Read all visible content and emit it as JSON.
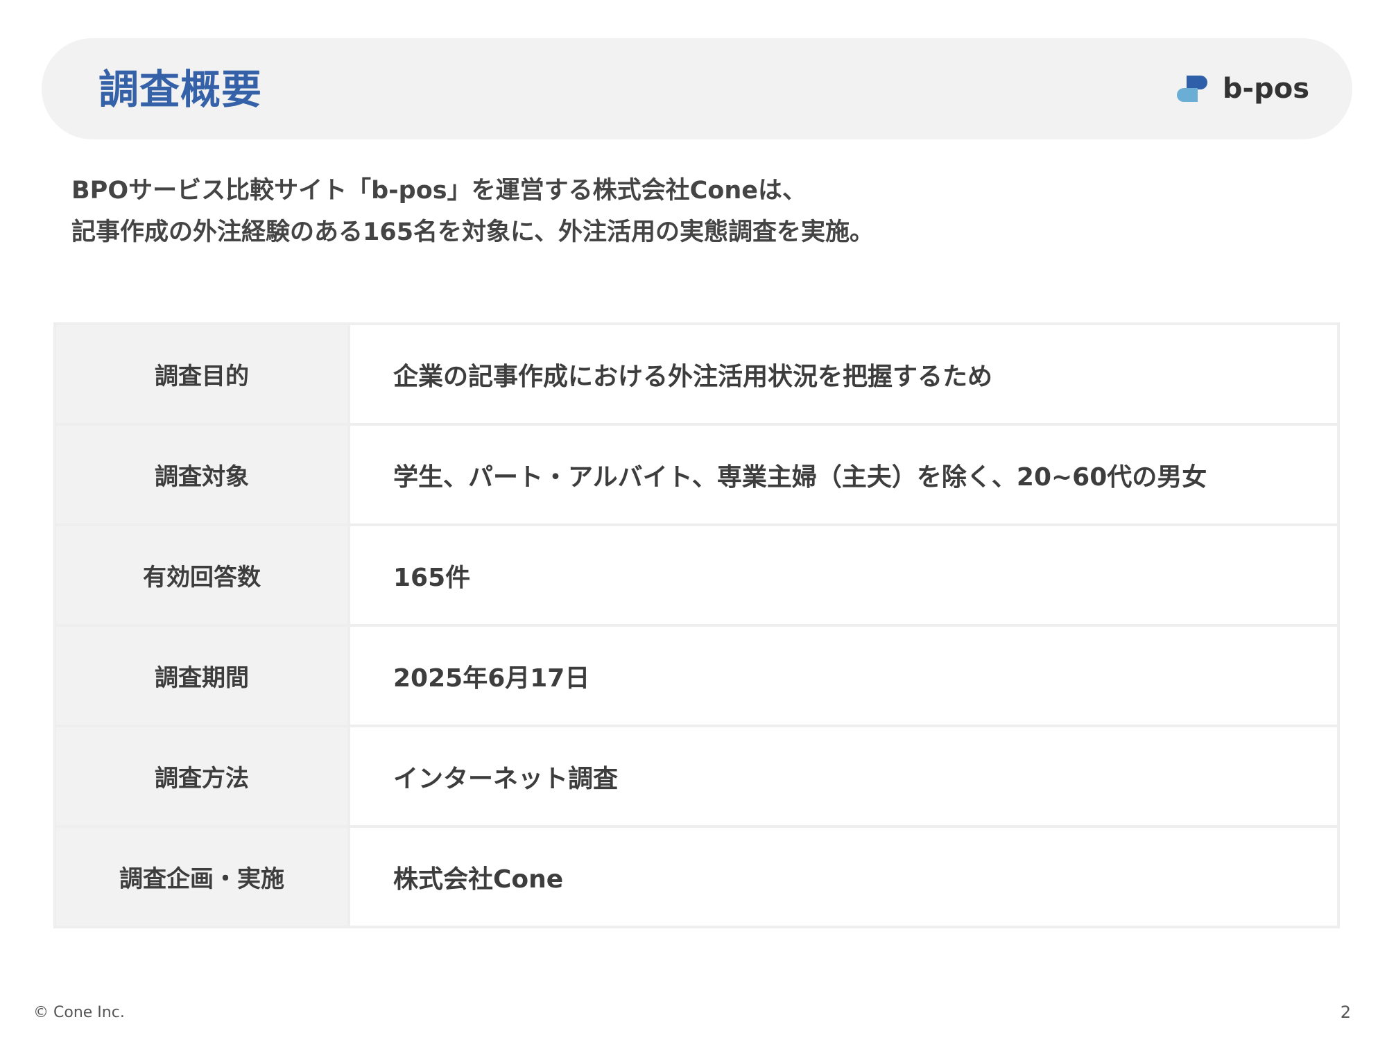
{
  "header": {
    "title": "調査概要",
    "logo_text": "b-pos",
    "logo_colors": [
      "#2f5fa8",
      "#6aaed6"
    ]
  },
  "intro": {
    "lines": [
      "BPOサービス比較サイト「b-pos」を運営する株式会社Coneは、",
      "記事作成の外注経験のある165名を対象に、外注活用の実態調査を実施。"
    ]
  },
  "table": {
    "rows": [
      {
        "label": "調査目的",
        "value": "企業の記事作成における外注活用状況を把握するため"
      },
      {
        "label": "調査対象",
        "value": "学生、パート・アルバイト、専業主婦（主夫）を除く、20~60代の男女"
      },
      {
        "label": "有効回答数",
        "value": "165件"
      },
      {
        "label": "調査期間",
        "value": "2025年6月17日"
      },
      {
        "label": "調査方法",
        "value": "インターネット調査"
      },
      {
        "label": "調査企画・実施",
        "value": "株式会社Cone"
      }
    ]
  },
  "footer": {
    "copyright": "© Cone Inc.",
    "page_number": "2"
  }
}
